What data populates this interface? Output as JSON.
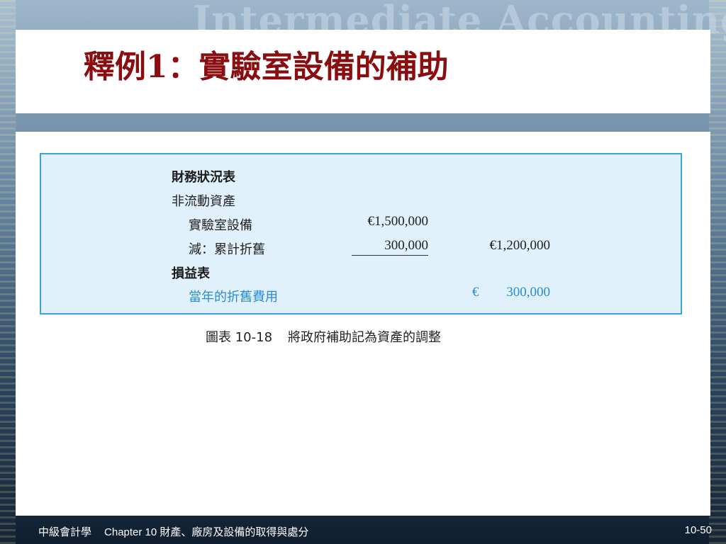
{
  "background": {
    "watermark": "Intermediate Accounting"
  },
  "slide": {
    "title": "釋例1：實驗室設備的補助"
  },
  "exhibit": {
    "sections": {
      "sfp_header": "財務狀況表",
      "noncurrent_header": "非流動資產",
      "equipment_label": "實驗室設備",
      "equipment_amount": "€1,500,000",
      "depreciation_label": "減：累計折舊",
      "depreciation_amount": "300,000",
      "net_amount": "€1,200,000",
      "income_header": "損益表",
      "expense_label": "當年的折舊費用",
      "expense_currency": "€",
      "expense_amount": "300,000"
    },
    "caption_number": "圖表 10-18",
    "caption_text": "將政府補助記為資產的調整"
  },
  "footer": {
    "course": "中級會計學",
    "chapter": "Chapter 10 財產、廠房及設備的取得與處分",
    "page": "10-50"
  },
  "colors": {
    "title": "#8a0e10",
    "exhibit_bg": "#e1f1fb",
    "exhibit_border": "#3ba4d9",
    "highlight_text": "#2a8bd1"
  }
}
